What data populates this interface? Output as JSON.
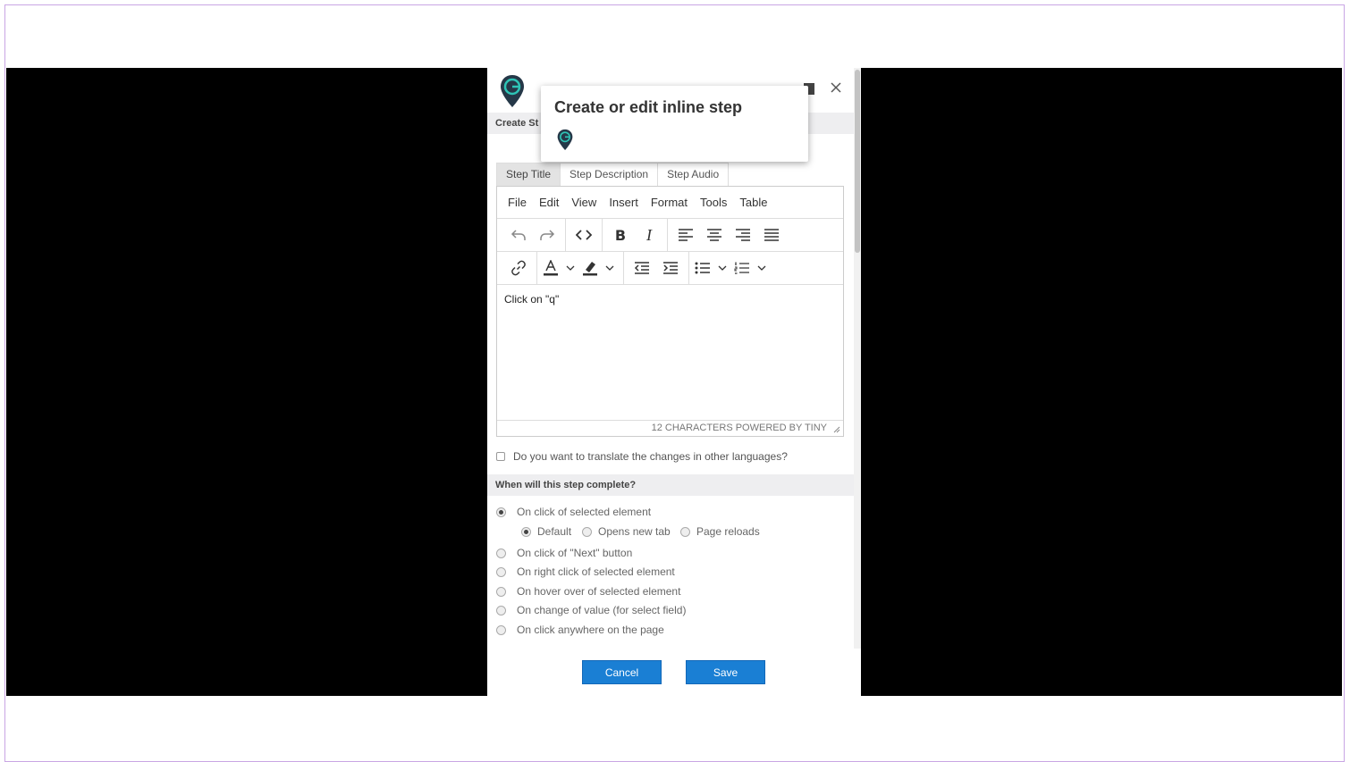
{
  "panel": {
    "create_header": "Create St",
    "tooltip_title": "Create or edit inline step"
  },
  "tabs": [
    "Step Title",
    "Step Description",
    "Step Audio"
  ],
  "menu": [
    "File",
    "Edit",
    "View",
    "Insert",
    "Format",
    "Tools",
    "Table"
  ],
  "editor": {
    "content": "Click on \"q\"",
    "status": "12 CHARACTERS  POWERED BY TINY"
  },
  "translate_label": "Do you want to translate the changes in other languages?",
  "complete_header": "When will this step complete?",
  "options": {
    "click_selected": "On click of selected element",
    "sub_default": "Default",
    "sub_new_tab": "Opens new tab",
    "sub_reloads": "Page reloads",
    "click_next": "On click of \"Next\" button",
    "right_click": "On right click of selected element",
    "hover": "On hover over of selected element",
    "change_value": "On change of value (for select field)",
    "click_anywhere": "On click anywhere on the page"
  },
  "buttons": {
    "cancel": "Cancel",
    "save": "Save"
  },
  "colors": {
    "accent": "#1a7fd4",
    "logo_dark": "#253848",
    "logo_teal": "#2ec4b6"
  }
}
